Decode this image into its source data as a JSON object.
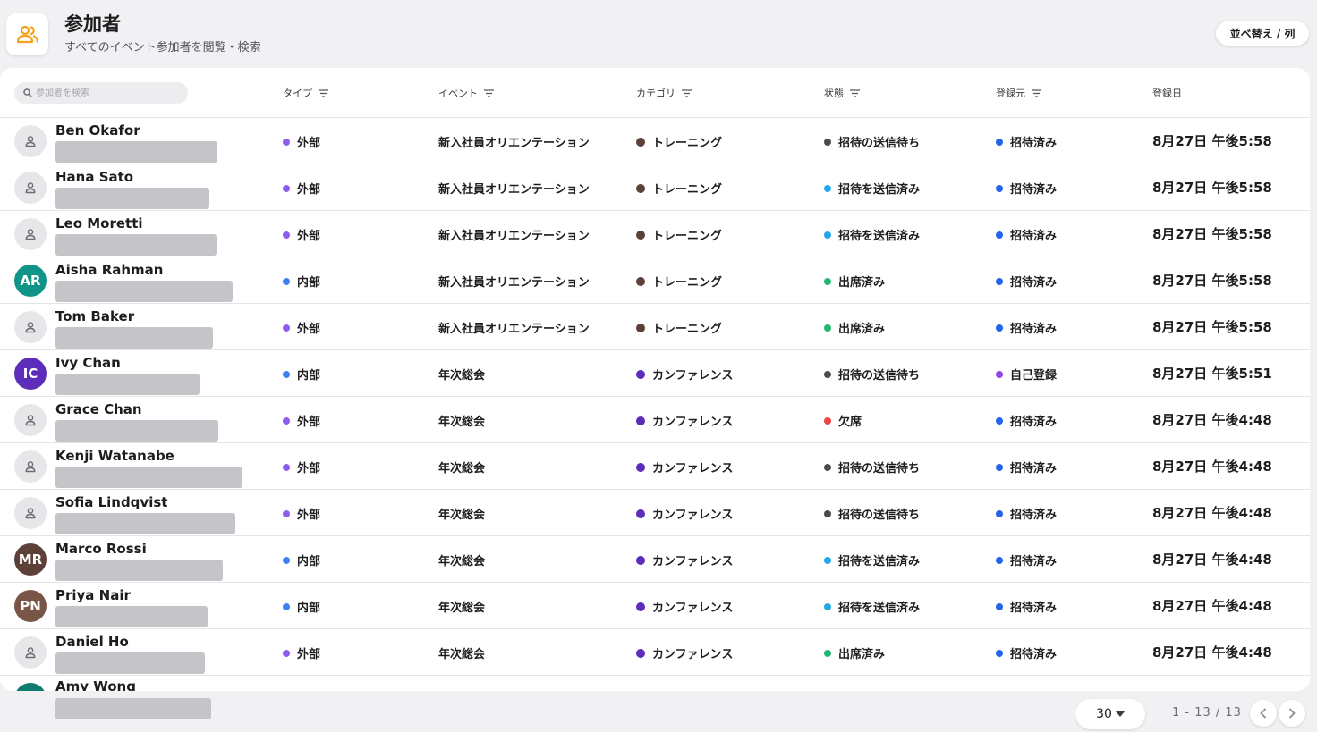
{
  "header": {
    "title": "参加者",
    "subtitle": "すべてのイベント参加者を閲覧・検索",
    "sort_label": "並べ替え / 列",
    "app_icon": "people-icon"
  },
  "table": {
    "search_placeholder": "参加者を検索",
    "columns": {
      "type": "タイプ",
      "event": "イベント",
      "category": "カテゴリ",
      "status": "状態",
      "source": "登録元",
      "date": "登録日"
    },
    "colors": {
      "external": "#8e5cf0",
      "internal": "#3a82f5",
      "training": "#5d4037",
      "conference": "#5b2dba",
      "pending": "#4a4a4f",
      "sent": "#22a8e6",
      "attended": "#22b573",
      "absent": "#ef4444",
      "invited": "#2563eb",
      "self": "#8e44e8"
    },
    "rows": [
      {
        "name": "Ben Okafor",
        "initials": "",
        "avatar_color": "",
        "type": "外部",
        "type_color": "#8e5cf0",
        "event": "新入社員オリエンテーション",
        "category": "トレーニング",
        "category_color": "#5d4037",
        "status": "招待の送信待ち",
        "status_color": "#4a4a4f",
        "source": "招待済み",
        "source_color": "#2563eb",
        "date": "8月27日 午後5:58"
      },
      {
        "name": "Hana Sato",
        "initials": "",
        "avatar_color": "",
        "type": "外部",
        "type_color": "#8e5cf0",
        "event": "新入社員オリエンテーション",
        "category": "トレーニング",
        "category_color": "#5d4037",
        "status": "招待を送信済み",
        "status_color": "#22a8e6",
        "source": "招待済み",
        "source_color": "#2563eb",
        "date": "8月27日 午後5:58"
      },
      {
        "name": "Leo Moretti",
        "initials": "",
        "avatar_color": "",
        "type": "外部",
        "type_color": "#8e5cf0",
        "event": "新入社員オリエンテーション",
        "category": "トレーニング",
        "category_color": "#5d4037",
        "status": "招待を送信済み",
        "status_color": "#22a8e6",
        "source": "招待済み",
        "source_color": "#2563eb",
        "date": "8月27日 午後5:58"
      },
      {
        "name": "Aisha Rahman",
        "initials": "AR",
        "avatar_color": "#0f9488",
        "type": "内部",
        "type_color": "#3a82f5",
        "event": "新入社員オリエンテーション",
        "category": "トレーニング",
        "category_color": "#5d4037",
        "status": "出席済み",
        "status_color": "#22b573",
        "source": "招待済み",
        "source_color": "#2563eb",
        "date": "8月27日 午後5:58"
      },
      {
        "name": "Tom Baker",
        "initials": "",
        "avatar_color": "",
        "type": "外部",
        "type_color": "#8e5cf0",
        "event": "新入社員オリエンテーション",
        "category": "トレーニング",
        "category_color": "#5d4037",
        "status": "出席済み",
        "status_color": "#22b573",
        "source": "招待済み",
        "source_color": "#2563eb",
        "date": "8月27日 午後5:58"
      },
      {
        "name": "Ivy Chan",
        "initials": "IC",
        "avatar_color": "#5b2dba",
        "type": "内部",
        "type_color": "#3a82f5",
        "event": "年次総会",
        "category": "カンファレンス",
        "category_color": "#5b2dba",
        "status": "招待の送信待ち",
        "status_color": "#4a4a4f",
        "source": "自己登録",
        "source_color": "#8e44e8",
        "date": "8月27日 午後5:51"
      },
      {
        "name": "Grace Chan",
        "initials": "",
        "avatar_color": "",
        "type": "外部",
        "type_color": "#8e5cf0",
        "event": "年次総会",
        "category": "カンファレンス",
        "category_color": "#5b2dba",
        "status": "欠席",
        "status_color": "#ef4444",
        "source": "招待済み",
        "source_color": "#2563eb",
        "date": "8月27日 午後4:48"
      },
      {
        "name": "Kenji Watanabe",
        "initials": "",
        "avatar_color": "",
        "type": "外部",
        "type_color": "#8e5cf0",
        "event": "年次総会",
        "category": "カンファレンス",
        "category_color": "#5b2dba",
        "status": "招待の送信待ち",
        "status_color": "#4a4a4f",
        "source": "招待済み",
        "source_color": "#2563eb",
        "date": "8月27日 午後4:48"
      },
      {
        "name": "Sofia Lindqvist",
        "initials": "",
        "avatar_color": "",
        "type": "外部",
        "type_color": "#8e5cf0",
        "event": "年次総会",
        "category": "カンファレンス",
        "category_color": "#5b2dba",
        "status": "招待の送信待ち",
        "status_color": "#4a4a4f",
        "source": "招待済み",
        "source_color": "#2563eb",
        "date": "8月27日 午後4:48"
      },
      {
        "name": "Marco Rossi",
        "initials": "MR",
        "avatar_color": "#5d4037",
        "type": "内部",
        "type_color": "#3a82f5",
        "event": "年次総会",
        "category": "カンファレンス",
        "category_color": "#5b2dba",
        "status": "招待を送信済み",
        "status_color": "#22a8e6",
        "source": "招待済み",
        "source_color": "#2563eb",
        "date": "8月27日 午後4:48"
      },
      {
        "name": "Priya Nair",
        "initials": "PN",
        "avatar_color": "#795548",
        "type": "内部",
        "type_color": "#3a82f5",
        "event": "年次総会",
        "category": "カンファレンス",
        "category_color": "#5b2dba",
        "status": "招待を送信済み",
        "status_color": "#22a8e6",
        "source": "招待済み",
        "source_color": "#2563eb",
        "date": "8月27日 午後4:48"
      },
      {
        "name": "Daniel Ho",
        "initials": "",
        "avatar_color": "",
        "type": "外部",
        "type_color": "#8e5cf0",
        "event": "年次総会",
        "category": "カンファレンス",
        "category_color": "#5b2dba",
        "status": "出席済み",
        "status_color": "#22b573",
        "source": "招待済み",
        "source_color": "#2563eb",
        "date": "8月27日 午後4:48"
      },
      {
        "name": "Amy Wong",
        "initials": "",
        "avatar_color": "#0f7a6e",
        "type": "",
        "type_color": "",
        "event": "",
        "category": "",
        "category_color": "",
        "status": "",
        "status_color": "",
        "source": "",
        "source_color": "",
        "date": ""
      }
    ]
  },
  "pagination": {
    "per_page": "30",
    "range": "1 - 13 / 13",
    "prev_icon": "chevron-left-icon",
    "next_icon": "chevron-right-icon"
  }
}
